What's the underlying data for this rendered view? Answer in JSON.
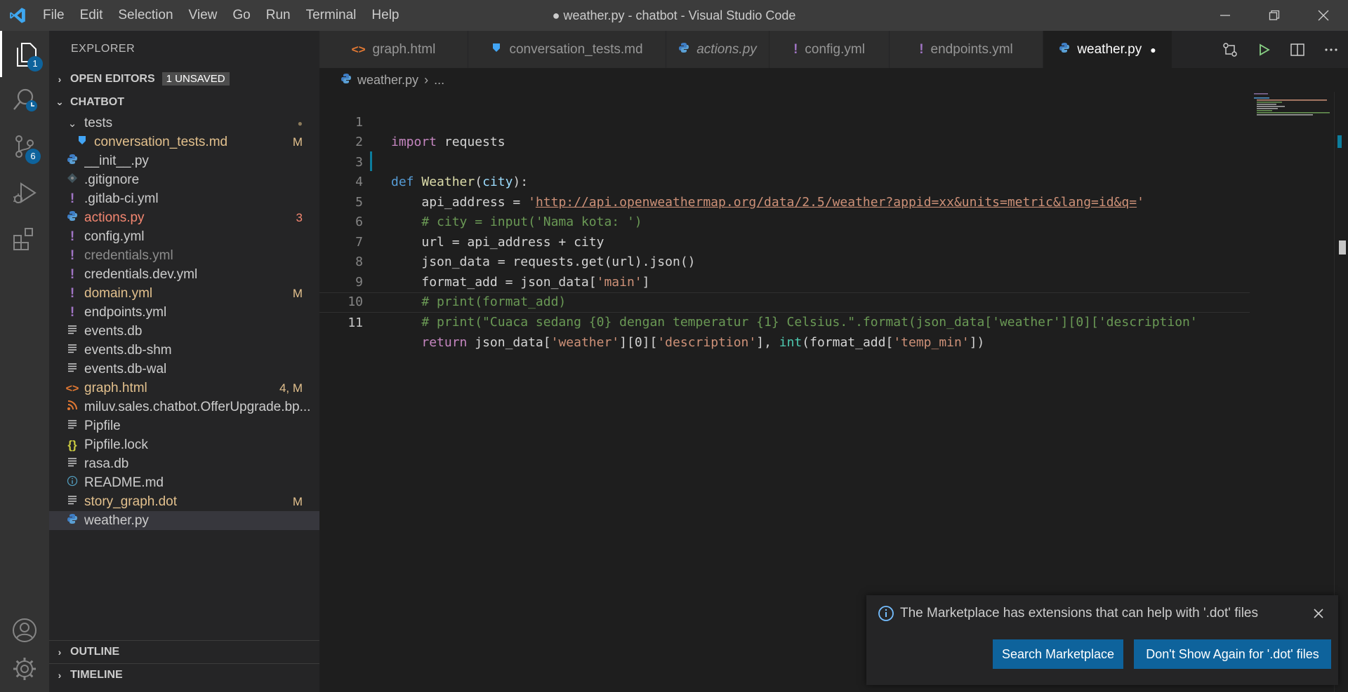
{
  "window": {
    "title": "● weather.py - chatbot - Visual Studio Code",
    "menu": [
      "File",
      "Edit",
      "Selection",
      "View",
      "Go",
      "Run",
      "Terminal",
      "Help"
    ]
  },
  "activity_bar": {
    "explorer_badge": "1",
    "scm_badge": "6"
  },
  "sidebar": {
    "title": "EXPLORER",
    "open_editors": {
      "label": "OPEN EDITORS",
      "badge": "1 UNSAVED"
    },
    "workspace": "CHATBOT",
    "files": [
      {
        "name": "tests",
        "icon": "chevron-down-icon",
        "decoration": "●",
        "color": "#cccccc",
        "deco_color": "#8b7a5a"
      },
      {
        "name": "conversation_tests.md",
        "icon": "markdown-icon",
        "decoration": "M",
        "color": "#e2c08d",
        "deco_color": "#e2c08d"
      },
      {
        "name": "__init__.py",
        "icon": "python-icon",
        "decoration": "",
        "color": "#cccccc"
      },
      {
        "name": ".gitignore",
        "icon": "git-icon",
        "decoration": "",
        "color": "#cccccc"
      },
      {
        "name": ".gitlab-ci.yml",
        "icon": "yaml-icon",
        "decoration": "",
        "color": "#cccccc"
      },
      {
        "name": "actions.py",
        "icon": "python-icon",
        "decoration": "3",
        "color": "#f48771",
        "deco_color": "#f48771"
      },
      {
        "name": "config.yml",
        "icon": "yaml-icon",
        "decoration": "",
        "color": "#cccccc"
      },
      {
        "name": "credentials.yml",
        "icon": "yaml-icon",
        "decoration": "",
        "color": "#8c8c8c"
      },
      {
        "name": "credentials.dev.yml",
        "icon": "yaml-icon",
        "decoration": "",
        "color": "#cccccc"
      },
      {
        "name": "domain.yml",
        "icon": "yaml-icon",
        "decoration": "M",
        "color": "#e2c08d",
        "deco_color": "#e2c08d"
      },
      {
        "name": "endpoints.yml",
        "icon": "yaml-icon",
        "decoration": "",
        "color": "#cccccc"
      },
      {
        "name": "events.db",
        "icon": "lines-icon",
        "decoration": "",
        "color": "#cccccc"
      },
      {
        "name": "events.db-shm",
        "icon": "lines-icon",
        "decoration": "",
        "color": "#cccccc"
      },
      {
        "name": "events.db-wal",
        "icon": "lines-icon",
        "decoration": "",
        "color": "#cccccc"
      },
      {
        "name": "graph.html",
        "icon": "html-icon",
        "decoration": "4, M",
        "color": "#e2c08d",
        "deco_color": "#e2c08d"
      },
      {
        "name": "miluv.sales.chatbot.OfferUpgrade.bp...",
        "icon": "rss-icon",
        "decoration": "",
        "color": "#cccccc"
      },
      {
        "name": "Pipfile",
        "icon": "lines-icon",
        "decoration": "",
        "color": "#cccccc"
      },
      {
        "name": "Pipfile.lock",
        "icon": "json-icon",
        "decoration": "",
        "color": "#cccccc"
      },
      {
        "name": "rasa.db",
        "icon": "lines-icon",
        "decoration": "",
        "color": "#cccccc"
      },
      {
        "name": "README.md",
        "icon": "info-icon",
        "decoration": "",
        "color": "#cccccc"
      },
      {
        "name": "story_graph.dot",
        "icon": "lines-icon",
        "decoration": "M",
        "color": "#e2c08d",
        "deco_color": "#e2c08d"
      },
      {
        "name": "weather.py",
        "icon": "python-icon",
        "decoration": "",
        "color": "#cccccc"
      }
    ],
    "outline": "OUTLINE",
    "timeline": "TIMELINE"
  },
  "tabs": [
    {
      "label": "graph.html",
      "icon": "html-icon",
      "italic": false,
      "active": false
    },
    {
      "label": "conversation_tests.md",
      "icon": "markdown-icon",
      "italic": false,
      "active": false
    },
    {
      "label": "actions.py",
      "icon": "python-icon",
      "italic": true,
      "active": false
    },
    {
      "label": "config.yml",
      "icon": "yaml-icon",
      "italic": false,
      "active": false
    },
    {
      "label": "endpoints.yml",
      "icon": "yaml-icon",
      "italic": false,
      "active": false
    },
    {
      "label": "weather.py",
      "icon": "python-icon",
      "italic": false,
      "active": true,
      "dirty": "●"
    }
  ],
  "breadcrumb": {
    "file": "weather.py",
    "sep": "›",
    "rest": "..."
  },
  "editor": {
    "line_numbers": [
      "1",
      "2",
      "3",
      "4",
      "5",
      "6",
      "7",
      "8",
      "9",
      "10",
      "11"
    ],
    "current_line": "11",
    "code": {
      "l1_kw": "import",
      "l1_rest": " requests",
      "l3_kw": "def",
      "l3_fn": "Weather",
      "l3_param": "city",
      "l4_var": "api_address",
      "l4_url": "http://api.openweathermap.org/data/2.5/weather?appid=xx&units=metric&lang=id&q=",
      "l5_cmt": "# city = input('Nama kota: ')",
      "l6": "url = api_address + city",
      "l7": "json_data = requests.get(url).json()",
      "l8_pre": "format_add = json_data[",
      "l8_str": "'main'",
      "l8_post": "]",
      "l9_cmt": "# print(format_add)",
      "l10_cmt": "# print(\"Cuaca sedang {0} dengan temperatur {1} Celsius.\".format(json_data['weather'][0]['description'",
      "l11_kw": "return",
      "l11_a": " json_data[",
      "l11_s1": "'weather'",
      "l11_b": "][0][",
      "l11_s2": "'description'",
      "l11_c": "], ",
      "l11_bi": "int",
      "l11_d": "(format_add[",
      "l11_s3": "'temp_min'",
      "l11_e": "])"
    }
  },
  "notification": {
    "message": "The Marketplace has extensions that can help with '.dot' files",
    "primary_button": "Search Marketplace",
    "secondary_button": "Don't Show Again for '.dot' files"
  },
  "colors": {
    "accent": "#0e639c",
    "title_bar": "#3c3c3c",
    "activity_bar": "#333333",
    "sidebar": "#252526",
    "editor": "#1e1e1e"
  }
}
